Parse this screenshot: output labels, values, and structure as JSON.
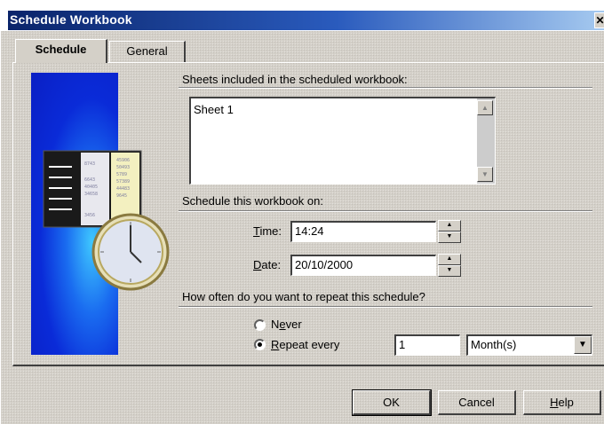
{
  "window": {
    "title": "Schedule Workbook",
    "close_glyph": "✕"
  },
  "tabs": [
    {
      "label": "Schedule",
      "active": true
    },
    {
      "label": "General",
      "active": false
    }
  ],
  "sheets": {
    "label": "Sheets included in the scheduled workbook:",
    "items": [
      "Sheet 1"
    ]
  },
  "schedule_on": {
    "label": "Schedule this workbook on:",
    "time_label_ul": "T",
    "time_label_rest": "ime:",
    "time_value": "14:24",
    "date_label_ul": "D",
    "date_label_rest": "ate:",
    "date_value": "20/10/2000"
  },
  "repeat": {
    "label": "How often do you want to repeat this schedule?",
    "never_pre": "N",
    "never_ul": "e",
    "never_rest": "ver",
    "repeat_ul": "R",
    "repeat_rest": "epeat every",
    "selected": "repeat",
    "interval_value": "1",
    "unit_selected": "Month(s)"
  },
  "buttons": {
    "ok": "OK",
    "cancel": "Cancel",
    "help_ul": "H",
    "help_rest": "elp"
  },
  "icons": {
    "illustration": "schedule-clock-spreadsheet-illustration",
    "scroll_up": "scroll-up-icon",
    "scroll_down": "scroll-down-icon",
    "spin_up": "spin-up-icon",
    "spin_down": "spin-down-icon",
    "dropdown": "chevron-down-icon"
  },
  "colors": {
    "titlebar_start": "#0a246a",
    "titlebar_end": "#a6caf0",
    "face": "#d4d0c8",
    "art_blue": "#0a2bd8"
  }
}
